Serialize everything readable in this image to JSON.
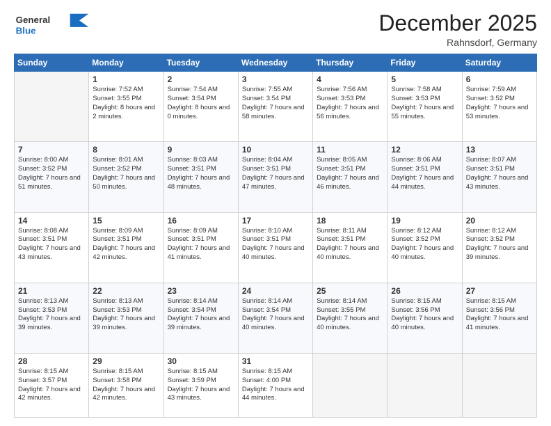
{
  "header": {
    "logo_general": "General",
    "logo_blue": "Blue",
    "month_year": "December 2025",
    "location": "Rahnsdorf, Germany"
  },
  "weekdays": [
    "Sunday",
    "Monday",
    "Tuesday",
    "Wednesday",
    "Thursday",
    "Friday",
    "Saturday"
  ],
  "weeks": [
    [
      {
        "day": "",
        "sunrise": "",
        "sunset": "",
        "daylight": ""
      },
      {
        "day": "1",
        "sunrise": "Sunrise: 7:52 AM",
        "sunset": "Sunset: 3:55 PM",
        "daylight": "Daylight: 8 hours and 2 minutes."
      },
      {
        "day": "2",
        "sunrise": "Sunrise: 7:54 AM",
        "sunset": "Sunset: 3:54 PM",
        "daylight": "Daylight: 8 hours and 0 minutes."
      },
      {
        "day": "3",
        "sunrise": "Sunrise: 7:55 AM",
        "sunset": "Sunset: 3:54 PM",
        "daylight": "Daylight: 7 hours and 58 minutes."
      },
      {
        "day": "4",
        "sunrise": "Sunrise: 7:56 AM",
        "sunset": "Sunset: 3:53 PM",
        "daylight": "Daylight: 7 hours and 56 minutes."
      },
      {
        "day": "5",
        "sunrise": "Sunrise: 7:58 AM",
        "sunset": "Sunset: 3:53 PM",
        "daylight": "Daylight: 7 hours and 55 minutes."
      },
      {
        "day": "6",
        "sunrise": "Sunrise: 7:59 AM",
        "sunset": "Sunset: 3:52 PM",
        "daylight": "Daylight: 7 hours and 53 minutes."
      }
    ],
    [
      {
        "day": "7",
        "sunrise": "Sunrise: 8:00 AM",
        "sunset": "Sunset: 3:52 PM",
        "daylight": "Daylight: 7 hours and 51 minutes."
      },
      {
        "day": "8",
        "sunrise": "Sunrise: 8:01 AM",
        "sunset": "Sunset: 3:52 PM",
        "daylight": "Daylight: 7 hours and 50 minutes."
      },
      {
        "day": "9",
        "sunrise": "Sunrise: 8:03 AM",
        "sunset": "Sunset: 3:51 PM",
        "daylight": "Daylight: 7 hours and 48 minutes."
      },
      {
        "day": "10",
        "sunrise": "Sunrise: 8:04 AM",
        "sunset": "Sunset: 3:51 PM",
        "daylight": "Daylight: 7 hours and 47 minutes."
      },
      {
        "day": "11",
        "sunrise": "Sunrise: 8:05 AM",
        "sunset": "Sunset: 3:51 PM",
        "daylight": "Daylight: 7 hours and 46 minutes."
      },
      {
        "day": "12",
        "sunrise": "Sunrise: 8:06 AM",
        "sunset": "Sunset: 3:51 PM",
        "daylight": "Daylight: 7 hours and 44 minutes."
      },
      {
        "day": "13",
        "sunrise": "Sunrise: 8:07 AM",
        "sunset": "Sunset: 3:51 PM",
        "daylight": "Daylight: 7 hours and 43 minutes."
      }
    ],
    [
      {
        "day": "14",
        "sunrise": "Sunrise: 8:08 AM",
        "sunset": "Sunset: 3:51 PM",
        "daylight": "Daylight: 7 hours and 43 minutes."
      },
      {
        "day": "15",
        "sunrise": "Sunrise: 8:09 AM",
        "sunset": "Sunset: 3:51 PM",
        "daylight": "Daylight: 7 hours and 42 minutes."
      },
      {
        "day": "16",
        "sunrise": "Sunrise: 8:09 AM",
        "sunset": "Sunset: 3:51 PM",
        "daylight": "Daylight: 7 hours and 41 minutes."
      },
      {
        "day": "17",
        "sunrise": "Sunrise: 8:10 AM",
        "sunset": "Sunset: 3:51 PM",
        "daylight": "Daylight: 7 hours and 40 minutes."
      },
      {
        "day": "18",
        "sunrise": "Sunrise: 8:11 AM",
        "sunset": "Sunset: 3:51 PM",
        "daylight": "Daylight: 7 hours and 40 minutes."
      },
      {
        "day": "19",
        "sunrise": "Sunrise: 8:12 AM",
        "sunset": "Sunset: 3:52 PM",
        "daylight": "Daylight: 7 hours and 40 minutes."
      },
      {
        "day": "20",
        "sunrise": "Sunrise: 8:12 AM",
        "sunset": "Sunset: 3:52 PM",
        "daylight": "Daylight: 7 hours and 39 minutes."
      }
    ],
    [
      {
        "day": "21",
        "sunrise": "Sunrise: 8:13 AM",
        "sunset": "Sunset: 3:53 PM",
        "daylight": "Daylight: 7 hours and 39 minutes."
      },
      {
        "day": "22",
        "sunrise": "Sunrise: 8:13 AM",
        "sunset": "Sunset: 3:53 PM",
        "daylight": "Daylight: 7 hours and 39 minutes."
      },
      {
        "day": "23",
        "sunrise": "Sunrise: 8:14 AM",
        "sunset": "Sunset: 3:54 PM",
        "daylight": "Daylight: 7 hours and 39 minutes."
      },
      {
        "day": "24",
        "sunrise": "Sunrise: 8:14 AM",
        "sunset": "Sunset: 3:54 PM",
        "daylight": "Daylight: 7 hours and 40 minutes."
      },
      {
        "day": "25",
        "sunrise": "Sunrise: 8:14 AM",
        "sunset": "Sunset: 3:55 PM",
        "daylight": "Daylight: 7 hours and 40 minutes."
      },
      {
        "day": "26",
        "sunrise": "Sunrise: 8:15 AM",
        "sunset": "Sunset: 3:56 PM",
        "daylight": "Daylight: 7 hours and 40 minutes."
      },
      {
        "day": "27",
        "sunrise": "Sunrise: 8:15 AM",
        "sunset": "Sunset: 3:56 PM",
        "daylight": "Daylight: 7 hours and 41 minutes."
      }
    ],
    [
      {
        "day": "28",
        "sunrise": "Sunrise: 8:15 AM",
        "sunset": "Sunset: 3:57 PM",
        "daylight": "Daylight: 7 hours and 42 minutes."
      },
      {
        "day": "29",
        "sunrise": "Sunrise: 8:15 AM",
        "sunset": "Sunset: 3:58 PM",
        "daylight": "Daylight: 7 hours and 42 minutes."
      },
      {
        "day": "30",
        "sunrise": "Sunrise: 8:15 AM",
        "sunset": "Sunset: 3:59 PM",
        "daylight": "Daylight: 7 hours and 43 minutes."
      },
      {
        "day": "31",
        "sunrise": "Sunrise: 8:15 AM",
        "sunset": "Sunset: 4:00 PM",
        "daylight": "Daylight: 7 hours and 44 minutes."
      },
      {
        "day": "",
        "sunrise": "",
        "sunset": "",
        "daylight": ""
      },
      {
        "day": "",
        "sunrise": "",
        "sunset": "",
        "daylight": ""
      },
      {
        "day": "",
        "sunrise": "",
        "sunset": "",
        "daylight": ""
      }
    ]
  ]
}
